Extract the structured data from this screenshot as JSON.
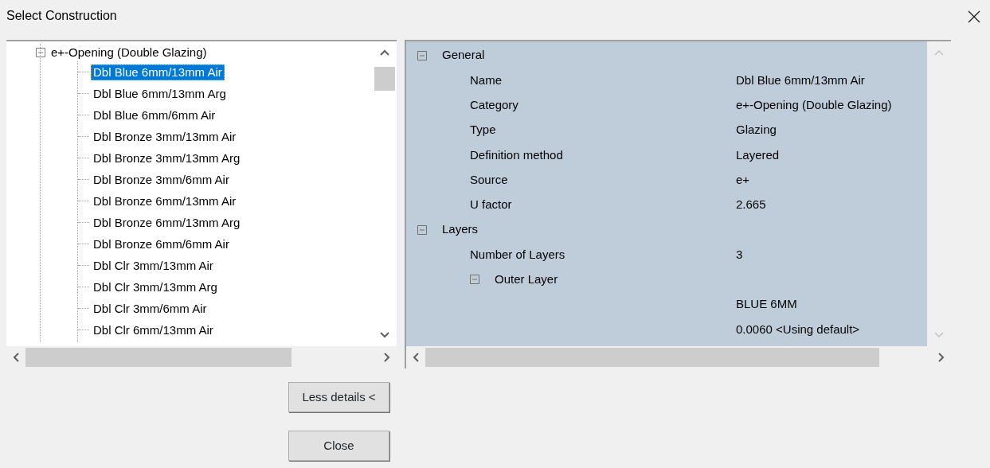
{
  "window": {
    "title": "Select Construction"
  },
  "tree": {
    "label": "e+-Opening (Double Glazing)",
    "expanded": true,
    "children": [
      {
        "label": "Dbl Blue 6mm/13mm Air",
        "selected": true
      },
      {
        "label": "Dbl Blue 6mm/13mm Arg",
        "selected": false
      },
      {
        "label": "Dbl Blue 6mm/6mm Air",
        "selected": false
      },
      {
        "label": "Dbl Bronze 3mm/13mm Air",
        "selected": false
      },
      {
        "label": "Dbl Bronze 3mm/13mm Arg",
        "selected": false
      },
      {
        "label": "Dbl Bronze 3mm/6mm Air",
        "selected": false
      },
      {
        "label": "Dbl Bronze 6mm/13mm Air",
        "selected": false
      },
      {
        "label": "Dbl Bronze 6mm/13mm Arg",
        "selected": false
      },
      {
        "label": "Dbl Bronze 6mm/6mm Air",
        "selected": false
      },
      {
        "label": "Dbl Clr 3mm/13mm Air",
        "selected": false
      },
      {
        "label": "Dbl Clr 3mm/13mm Arg",
        "selected": false
      },
      {
        "label": "Dbl Clr 3mm/6mm Air",
        "selected": false
      },
      {
        "label": "Dbl Clr 6mm/13mm Air",
        "selected": false
      }
    ]
  },
  "properties": [
    {
      "kind": "group",
      "label": "General",
      "expanded": true,
      "children": [
        {
          "kind": "field",
          "label": "Name",
          "value": "Dbl Blue 6mm/13mm Air"
        },
        {
          "kind": "field",
          "label": "Category",
          "value": "e+-Opening (Double Glazing)"
        },
        {
          "kind": "field",
          "label": "Type",
          "value": "Glazing"
        },
        {
          "kind": "field",
          "label": "Definition method",
          "value": "Layered"
        },
        {
          "kind": "field",
          "label": "Source",
          "value": "e+"
        },
        {
          "kind": "field",
          "label": "U factor",
          "value": "2.665"
        }
      ]
    },
    {
      "kind": "group",
      "label": "Layers",
      "expanded": true,
      "children": [
        {
          "kind": "field",
          "label": "Number of Layers",
          "value": "3"
        },
        {
          "kind": "group",
          "label": "Outer Layer",
          "expanded": true,
          "children": [
            {
              "kind": "value",
              "value": "BLUE 6MM"
            },
            {
              "kind": "value",
              "value": "0.0060 <Using default>"
            }
          ]
        }
      ]
    }
  ],
  "buttons": [
    {
      "label": "Less details <"
    },
    {
      "label": "Close"
    }
  ]
}
